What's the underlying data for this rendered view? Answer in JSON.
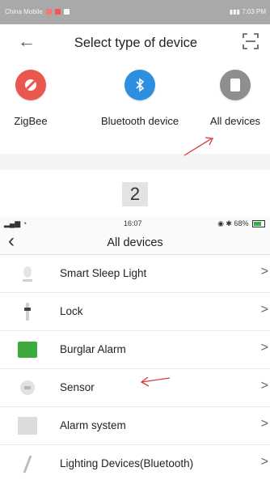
{
  "panel1": {
    "status_bar": {
      "carrier": "China Mobile",
      "time": "7:03 PM"
    },
    "back_icon": "back-arrow-icon",
    "title": "Select type of device",
    "scan_icon": "scan-icon",
    "devices": [
      {
        "label": "ZigBee",
        "color": "#e8584f"
      },
      {
        "label": "Bluetooth device",
        "color": "#2d8fe0"
      },
      {
        "label": "All devices",
        "color": "#8e8e8e"
      }
    ]
  },
  "step_number": "2",
  "panel2": {
    "status_bar": {
      "time": "16:07",
      "battery": "68%"
    },
    "title": "All devices",
    "items": [
      {
        "label": "Smart Sleep Light"
      },
      {
        "label": "Lock"
      },
      {
        "label": "Burglar Alarm"
      },
      {
        "label": "Sensor"
      },
      {
        "label": "Alarm system"
      },
      {
        "label": "Lighting Devices(Bluetooth)"
      }
    ],
    "chevron": ">"
  },
  "annotation_color": "#d93a3a"
}
